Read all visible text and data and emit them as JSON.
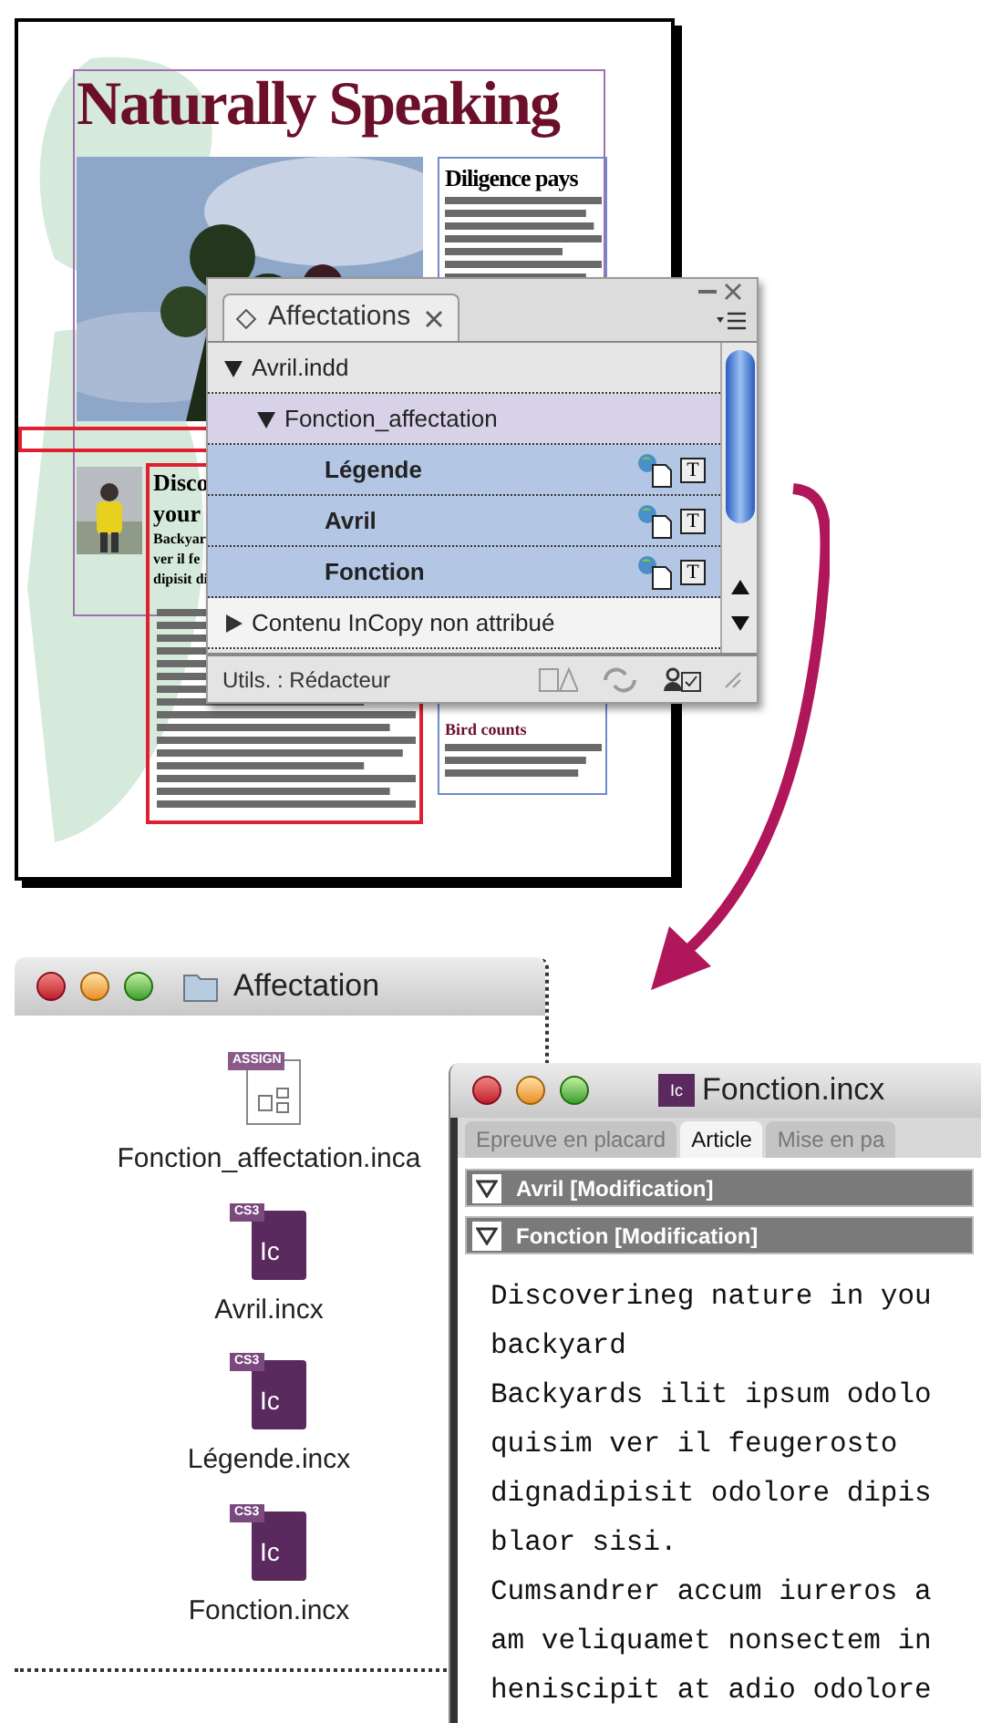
{
  "layout_page": {
    "headline": "Naturally Speaking",
    "sidebar_heading": "Diligence pays",
    "story_heading_lines": [
      "Disco",
      "your"
    ],
    "story_body_lines": [
      "Backyar",
      "ver il fe",
      "dipisit di"
    ],
    "caption_heading": "Bird counts"
  },
  "assignments_panel": {
    "tab": "Affectations",
    "tree": [
      {
        "label": "Avril.indd",
        "kind": "document",
        "expanded": true,
        "children": [
          {
            "label": "Fonction_affectation",
            "kind": "assignment",
            "expanded": true,
            "children": [
              {
                "label": "Légende",
                "kind": "story",
                "selected": true,
                "frame_symbol": "T"
              },
              {
                "label": "Avril",
                "kind": "story",
                "selected": true,
                "frame_symbol": "T"
              },
              {
                "label": "Fonction",
                "kind": "story",
                "selected": true,
                "frame_symbol": "T"
              }
            ]
          }
        ]
      },
      {
        "label": "Contenu InCopy non attribué",
        "kind": "group",
        "expanded": false
      }
    ],
    "user": "Utils. : Rédacteur"
  },
  "finder_window": {
    "title": "Affectation",
    "files": [
      {
        "name": "Fonction_affectation.inca",
        "kind": "assignment",
        "badge": "ASSIGN"
      },
      {
        "name": "Avril.incx",
        "kind": "incopy",
        "badge": "CS3",
        "logo": "Ic"
      },
      {
        "name": "Légende.incx",
        "kind": "incopy",
        "badge": "CS3",
        "logo": "Ic"
      },
      {
        "name": "Fonction.incx",
        "kind": "incopy",
        "badge": "CS3",
        "logo": "Ic"
      }
    ]
  },
  "incopy_window": {
    "title": "Fonction.incx",
    "title_icon": "Ic",
    "tabs": [
      {
        "label": "Epreuve en placard",
        "selected": false
      },
      {
        "label": "Article",
        "selected": true
      },
      {
        "label": "Mise en pa",
        "selected": false
      }
    ],
    "stories": [
      {
        "label": "Avril [Modification]",
        "expanded": true
      },
      {
        "label": "Fonction [Modification]",
        "expanded": true
      }
    ],
    "text_lines": [
      "Discoverineg nature in you",
      "backyard",
      "Backyards ilit ipsum odolo",
      "quisim ver il feugerosto",
      "dignadipisit odolore dipis",
      "blaor sisi.",
      "Cumsandrer accum iureros a",
      "am veliquamet nonsectem in",
      "heniscipit at adio odolore"
    ]
  }
}
